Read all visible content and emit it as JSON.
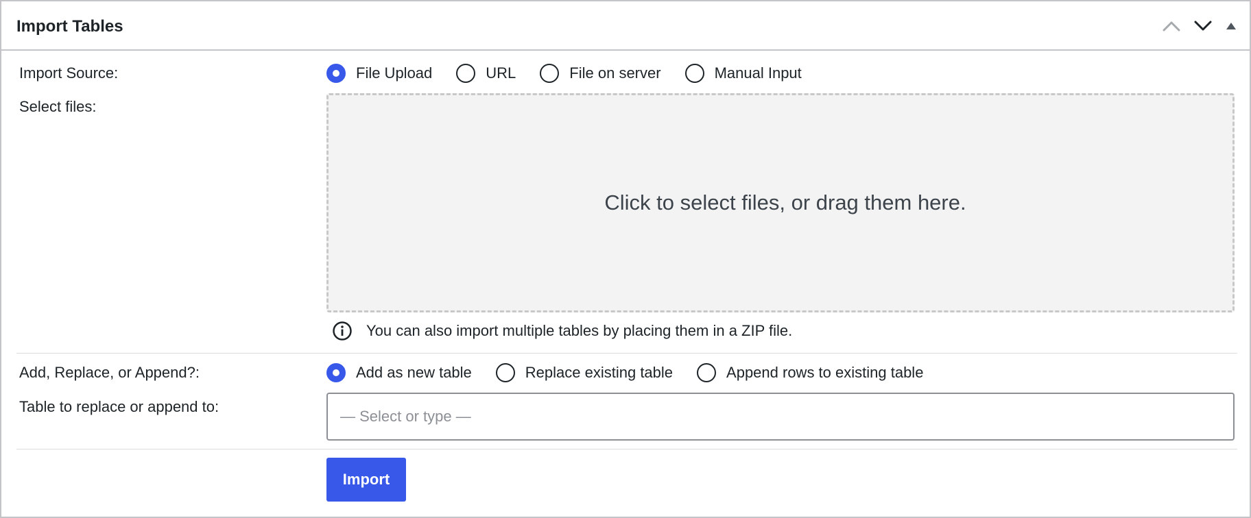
{
  "panel": {
    "title": "Import Tables",
    "controls": {
      "move_up": "chevron-up-icon",
      "move_down": "chevron-down-icon",
      "toggle": "triangle-up-icon"
    }
  },
  "import_source": {
    "label": "Import Source:",
    "options": [
      {
        "label": "File Upload",
        "checked": true
      },
      {
        "label": "URL",
        "checked": false
      },
      {
        "label": "File on server",
        "checked": false
      },
      {
        "label": "Manual Input",
        "checked": false
      }
    ]
  },
  "select_files": {
    "label": "Select files:",
    "dropzone_text": "Click to select files, or drag them here.",
    "info_icon": "info-icon",
    "info_text": "You can also import multiple tables by placing them in a ZIP file."
  },
  "import_type": {
    "label": "Add, Replace, or Append?:",
    "options": [
      {
        "label": "Add as new table",
        "checked": true
      },
      {
        "label": "Replace existing table",
        "checked": false
      },
      {
        "label": "Append rows to existing table",
        "checked": false
      }
    ]
  },
  "target_table": {
    "label": "Table to replace or append to:",
    "placeholder": "— Select or type —",
    "value": ""
  },
  "actions": {
    "import_label": "Import"
  },
  "colors": {
    "accent": "#3858e9",
    "border": "#c3c4c7",
    "dropzone_bg": "#f3f3f3",
    "text": "#1d2327"
  }
}
